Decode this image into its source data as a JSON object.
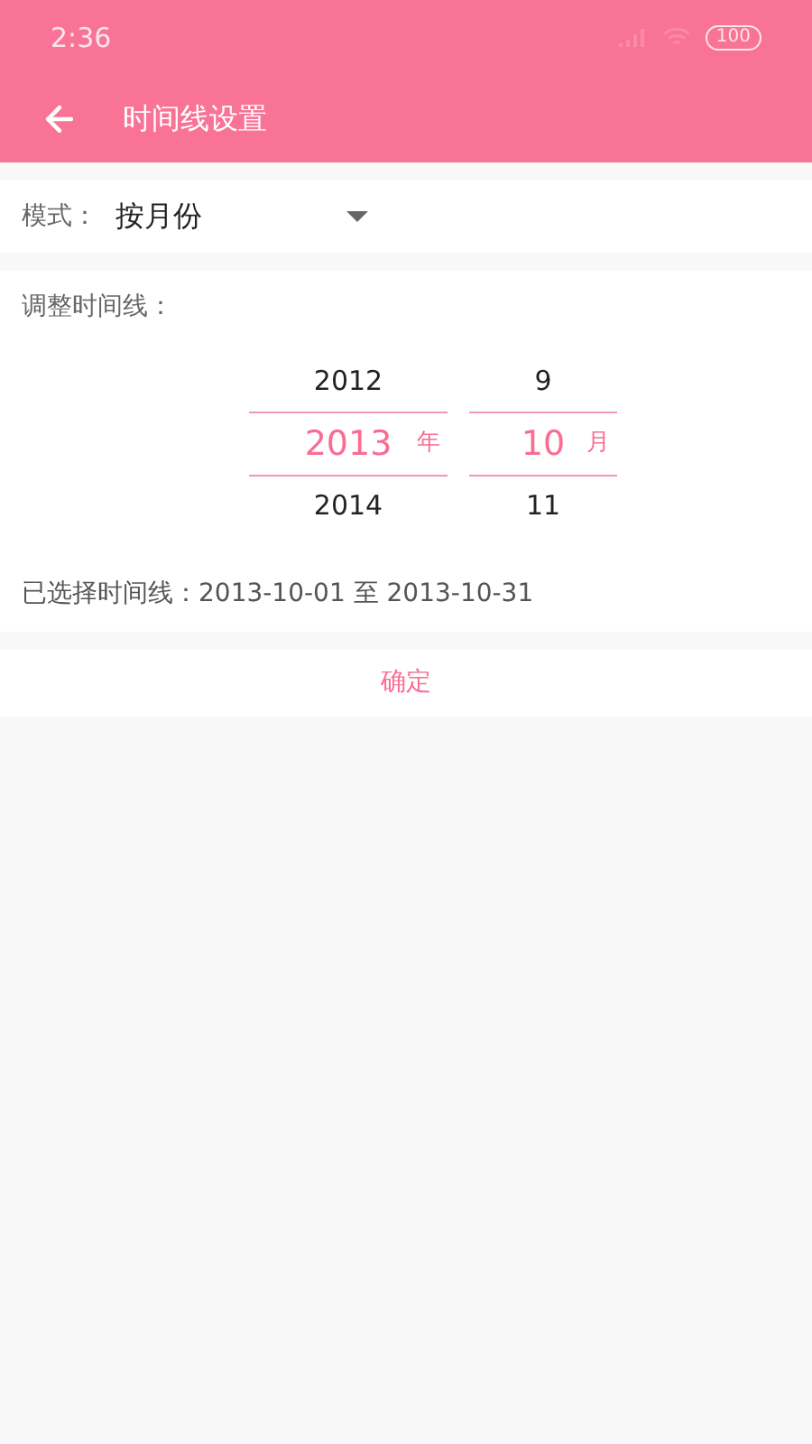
{
  "status_bar": {
    "time": "2:36",
    "battery": "100"
  },
  "toolbar": {
    "title": "时间线设置"
  },
  "mode": {
    "label": "模式：",
    "value": "按月份"
  },
  "timeline": {
    "label": "调整时间线：",
    "pickers": [
      {
        "unit": "年",
        "items": [
          {
            "text": "2012",
            "selected": false
          },
          {
            "text": "2013",
            "selected": true
          },
          {
            "text": "2014",
            "selected": false
          }
        ]
      },
      {
        "unit": "月",
        "items": [
          {
            "text": "9",
            "selected": false
          },
          {
            "text": "10",
            "selected": true
          },
          {
            "text": "11",
            "selected": false
          }
        ]
      }
    ],
    "summary": "已选择时间线：2013-10-01 至 2013-10-31"
  },
  "confirm_button": "确定"
}
